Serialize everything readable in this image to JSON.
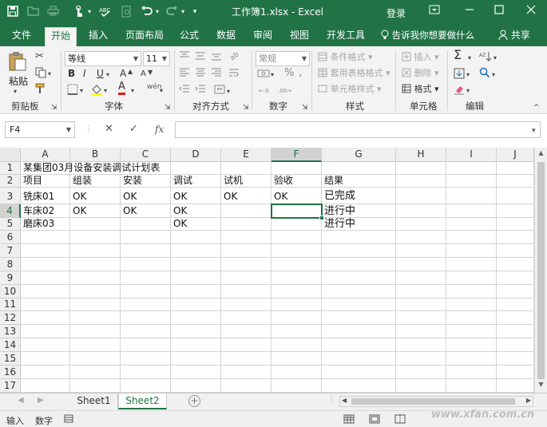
{
  "window": {
    "title": "工作簿1.xlsx - Excel",
    "login": "登录",
    "controls": {
      "restore_ribbon": "⊡",
      "minimize": "—",
      "maximize": "☐",
      "close": "✕"
    }
  },
  "quick_access": [
    {
      "icon": "save-icon",
      "glyph": "🖫"
    },
    {
      "icon": "open-icon",
      "glyph": "▭"
    },
    {
      "icon": "touch-mode-icon",
      "glyph": "☝"
    },
    {
      "icon": "spelling-icon",
      "glyph": "✓"
    },
    {
      "icon": "preview-icon",
      "glyph": "▢"
    },
    {
      "icon": "undo-icon",
      "glyph": "↶"
    },
    {
      "icon": "redo-icon",
      "glyph": "↷"
    },
    {
      "icon": "customize-icon",
      "glyph": "▾"
    }
  ],
  "ribbon_tabs": [
    "文件",
    "开始",
    "插入",
    "页面布局",
    "公式",
    "数据",
    "审阅",
    "视图",
    "开发工具"
  ],
  "active_tab": "开始",
  "tell_me": "告诉我你想要做什么",
  "share": "共享",
  "ribbon": {
    "clipboard": {
      "label": "剪贴板",
      "paste": "粘贴"
    },
    "font": {
      "label": "字体",
      "name": "等线",
      "size": "11",
      "bold": "B",
      "italic": "I",
      "underline": "U",
      "increase": "A",
      "decrease": "A",
      "color": "A",
      "phonetic": "wén"
    },
    "alignment": {
      "label": "对齐方式"
    },
    "number": {
      "label": "数字",
      "format": "常规",
      "percent": "%",
      "comma": ","
    },
    "styles": {
      "label": "样式",
      "conditional": "条件格式",
      "table": "套用表格格式",
      "cell_styles": "单元格样式"
    },
    "cells": {
      "label": "单元格",
      "insert": "插入",
      "delete": "删除",
      "format": "格式"
    },
    "editing": {
      "label": "编辑",
      "sum": "Σ"
    }
  },
  "formula_bar": {
    "name_box": "F4",
    "cancel": "✕",
    "enter": "✓",
    "fx": "fx",
    "value": ""
  },
  "columns": [
    "A",
    "B",
    "C",
    "D",
    "E",
    "F",
    "G",
    "H",
    "I",
    "J"
  ],
  "selected_column": "F",
  "rows": [
    "1",
    "2",
    "3",
    "4",
    "5",
    "6",
    "7",
    "8",
    "9",
    "10",
    "11",
    "12",
    "13",
    "14",
    "15",
    "16",
    "17"
  ],
  "selected_row": "4",
  "cells": {
    "A1": "某集团03月设备安装调试计划表",
    "A2": "项目",
    "B2": "组装",
    "C2": "安装",
    "D2": "调试",
    "E2": "试机",
    "F2": "验收",
    "G2": "结果",
    "A3": "铣床01",
    "B3": "OK",
    "C3": "OK",
    "D3": "OK",
    "E3": "OK",
    "F3": "OK",
    "G3": "已完成",
    "A4": "车床02",
    "B4": "OK",
    "C4": "OK",
    "D4": "OK",
    "G4": "进行中",
    "A5": "磨床03",
    "D5": "OK",
    "G5": "进行中"
  },
  "sheets": [
    "Sheet1",
    "Sheet2"
  ],
  "active_sheet": "Sheet2",
  "status": {
    "mode": "输入",
    "num": "数字"
  },
  "watermark": "www.xfan.com.cn"
}
